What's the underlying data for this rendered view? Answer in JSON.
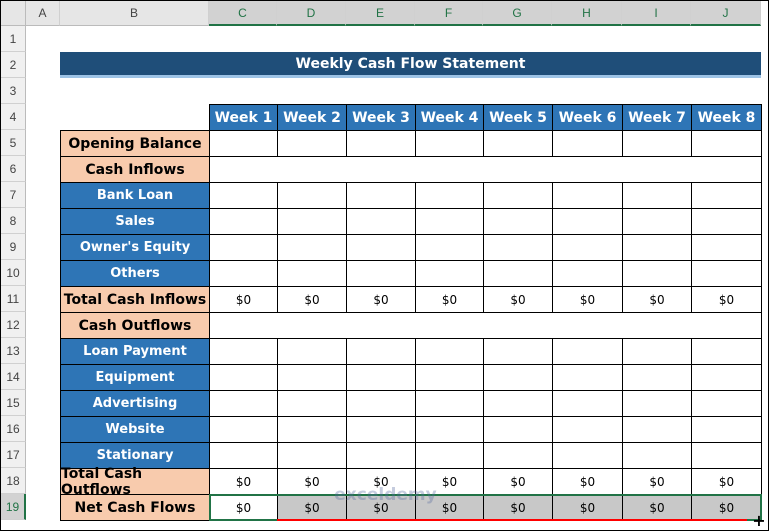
{
  "columns": [
    "A",
    "B",
    "C",
    "D",
    "E",
    "F",
    "G",
    "H",
    "I",
    "J"
  ],
  "rows": [
    "1",
    "2",
    "3",
    "4",
    "5",
    "6",
    "7",
    "8",
    "9",
    "10",
    "11",
    "12",
    "13",
    "14",
    "15",
    "16",
    "17",
    "18",
    "19"
  ],
  "title": "Weekly Cash Flow Statement",
  "weeks": [
    "Week 1",
    "Week 2",
    "Week 3",
    "Week 4",
    "Week 5",
    "Week 6",
    "Week 7",
    "Week 8"
  ],
  "line_items": [
    {
      "row": 5,
      "label": "Opening Balance",
      "style": "peach",
      "values": [
        "",
        "",
        "",
        "",
        "",
        "",
        "",
        ""
      ]
    },
    {
      "row": 6,
      "label": "Cash Inflows",
      "style": "peach",
      "merged": true
    },
    {
      "row": 7,
      "label": "Bank Loan",
      "style": "blue",
      "values": [
        "",
        "",
        "",
        "",
        "",
        "",
        "",
        ""
      ]
    },
    {
      "row": 8,
      "label": "Sales",
      "style": "blue",
      "values": [
        "",
        "",
        "",
        "",
        "",
        "",
        "",
        ""
      ]
    },
    {
      "row": 9,
      "label": "Owner's Equity",
      "style": "blue",
      "values": [
        "",
        "",
        "",
        "",
        "",
        "",
        "",
        ""
      ]
    },
    {
      "row": 10,
      "label": "Others",
      "style": "blue",
      "values": [
        "",
        "",
        "",
        "",
        "",
        "",
        "",
        ""
      ]
    },
    {
      "row": 11,
      "label": "Total Cash Inflows",
      "style": "peach",
      "values": [
        "$0",
        "$0",
        "$0",
        "$0",
        "$0",
        "$0",
        "$0",
        "$0"
      ]
    },
    {
      "row": 12,
      "label": "Cash Outflows",
      "style": "peach",
      "merged": true
    },
    {
      "row": 13,
      "label": "Loan Payment",
      "style": "blue",
      "values": [
        "",
        "",
        "",
        "",
        "",
        "",
        "",
        ""
      ]
    },
    {
      "row": 14,
      "label": "Equipment",
      "style": "blue",
      "values": [
        "",
        "",
        "",
        "",
        "",
        "",
        "",
        ""
      ]
    },
    {
      "row": 15,
      "label": "Advertising",
      "style": "blue",
      "values": [
        "",
        "",
        "",
        "",
        "",
        "",
        "",
        ""
      ]
    },
    {
      "row": 16,
      "label": "Website",
      "style": "blue",
      "values": [
        "",
        "",
        "",
        "",
        "",
        "",
        "",
        ""
      ]
    },
    {
      "row": 17,
      "label": "Stationary",
      "style": "blue",
      "values": [
        "",
        "",
        "",
        "",
        "",
        "",
        "",
        ""
      ]
    },
    {
      "row": 18,
      "label": "Total Cash Outflows",
      "style": "peach",
      "values": [
        "$0",
        "$0",
        "$0",
        "$0",
        "$0",
        "$0",
        "$0",
        "$0"
      ]
    },
    {
      "row": 19,
      "label": "Net Cash Flows",
      "style": "peach",
      "values": [
        "$0",
        "$0",
        "$0",
        "$0",
        "$0",
        "$0",
        "$0",
        "$0"
      ]
    }
  ],
  "selection": "C19:J19",
  "watermark": "exceldemy EXCEL · DATA · BI",
  "colors": {
    "title": "#1f4e79",
    "header_blue": "#2e75b6",
    "peach": "#f8cbad",
    "selection": "#217346",
    "fill_arrow": "#ff0000"
  }
}
